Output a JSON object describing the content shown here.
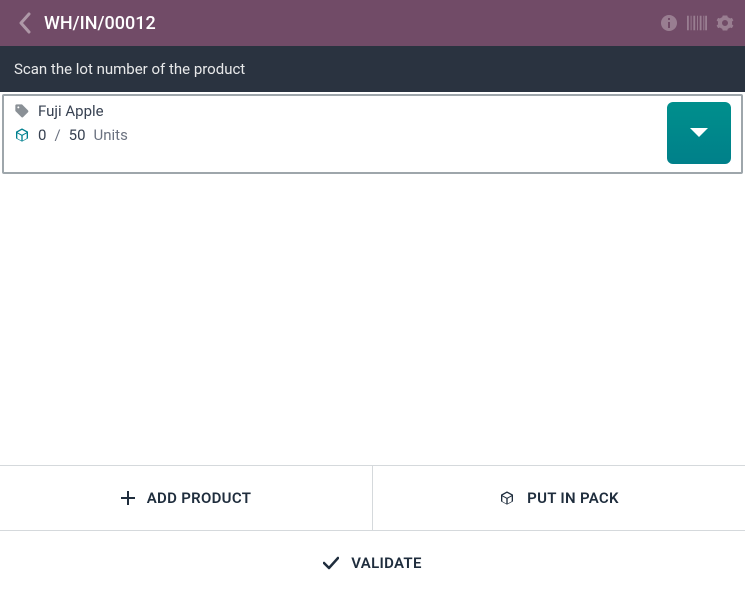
{
  "header": {
    "title": "WH/IN/00012"
  },
  "instruction": "Scan the lot number of the product",
  "line": {
    "product": "Fuji Apple",
    "qty_done": "0",
    "qty_slash": "/",
    "qty_demand": "50",
    "uom": "Units"
  },
  "buttons": {
    "add_product": "ADD PRODUCT",
    "put_in_pack": "PUT IN PACK",
    "validate": "VALIDATE"
  }
}
